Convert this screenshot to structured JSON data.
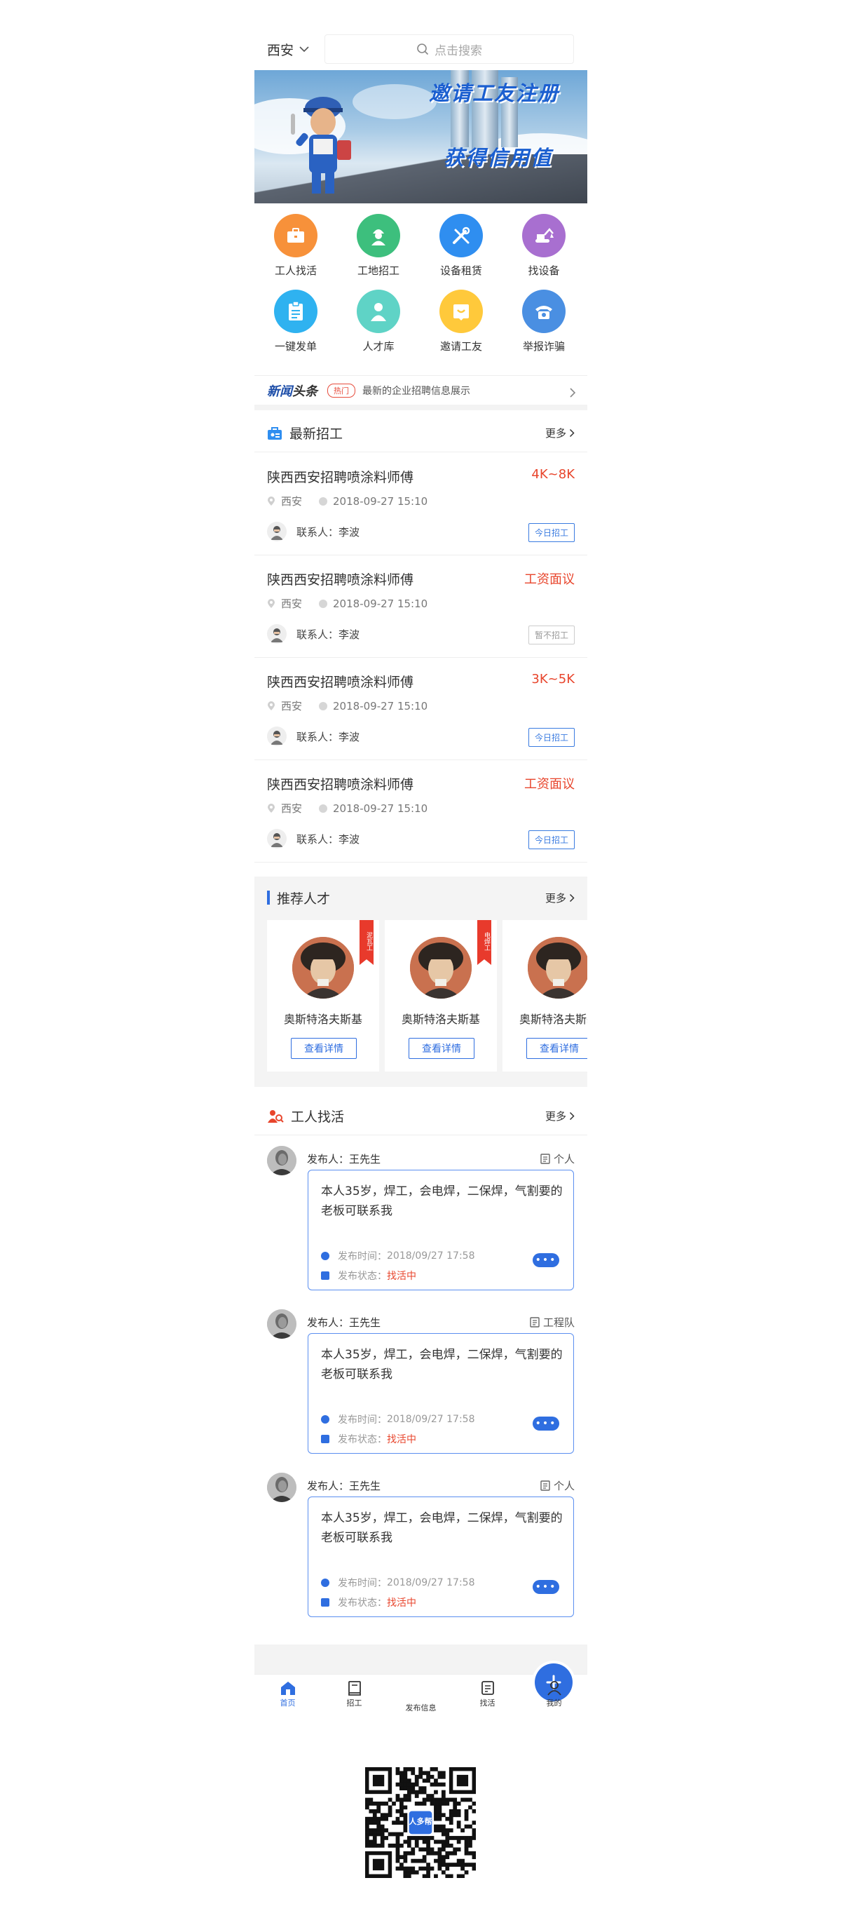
{
  "header": {
    "city": "西安",
    "search_placeholder": "点击搜索"
  },
  "banner": {
    "line1": "邀请工友注册",
    "line2": "获得信用值"
  },
  "grid": [
    {
      "label": "工人找活",
      "color": "#f7913a",
      "icon": "briefcase-icon"
    },
    {
      "label": "工地招工",
      "color": "#3dbf7d",
      "icon": "worker-icon"
    },
    {
      "label": "设备租赁",
      "color": "#2f8ef0",
      "icon": "tools-icon"
    },
    {
      "label": "找设备",
      "color": "#a86fd0",
      "icon": "excavator-icon"
    },
    {
      "label": "一键发单",
      "color": "#2fb2f0",
      "icon": "clipboard-icon"
    },
    {
      "label": "人才库",
      "color": "#5fd3c6",
      "icon": "person-icon"
    },
    {
      "label": "邀请工友",
      "color": "#ffc93b",
      "icon": "invite-icon"
    },
    {
      "label": "举报诈骗",
      "color": "#4a8fe2",
      "icon": "phone-icon"
    }
  ],
  "news": {
    "brand_a": "新闻",
    "brand_b": "头条",
    "badge": "热门",
    "text": "最新的企业招聘信息展示"
  },
  "jobs_section": {
    "title": "最新招工",
    "more": "更多"
  },
  "jobs": [
    {
      "title": "陕西西安招聘喷涂料师傅",
      "salary": "4K~8K",
      "city": "西安",
      "time": "2018-09-27 15:10",
      "contact": "联系人：李波",
      "tag": "今日招工"
    },
    {
      "title": "陕西西安招聘喷涂料师傅",
      "salary": "工资面议",
      "city": "西安",
      "time": "2018-09-27 15:10",
      "contact": "联系人：李波",
      "tag": "暂不招工"
    },
    {
      "title": "陕西西安招聘喷涂料师傅",
      "salary": "3K~5K",
      "city": "西安",
      "time": "2018-09-27 15:10",
      "contact": "联系人：李波",
      "tag": "今日招工"
    },
    {
      "title": "陕西西安招聘喷涂料师傅",
      "salary": "工资面议",
      "city": "西安",
      "time": "2018-09-27 15:10",
      "contact": "联系人：李波",
      "tag": "今日招工"
    }
  ],
  "talent_section": {
    "title": "推荐人才",
    "more": "更多"
  },
  "talents": [
    {
      "name": "奥斯特洛夫斯基",
      "ribbon": "泥瓦工",
      "button": "查看详情"
    },
    {
      "name": "奥斯特洛夫斯基",
      "ribbon": "电焊工",
      "button": "查看详情"
    },
    {
      "name": "奥斯特洛夫斯基",
      "ribbon": "",
      "button": "查看详情"
    }
  ],
  "workers_section": {
    "title": "工人找活",
    "more": "更多"
  },
  "posts": [
    {
      "publisher": "发布人：王先生",
      "kind": "个人",
      "desc": "本人35岁，焊工，会电焊，二保焊，气割要的老板可联系我",
      "time_label": "发布时间：",
      "time": "2018/09/27 17:58",
      "status_label": "发布状态：",
      "status": "找活中"
    },
    {
      "publisher": "发布人：王先生",
      "kind": "工程队",
      "desc": "本人35岁，焊工，会电焊，二保焊，气割要的老板可联系我",
      "time_label": "发布时间：",
      "time": "2018/09/27 17:58",
      "status_label": "发布状态：",
      "status": "找活中"
    },
    {
      "publisher": "发布人：王先生",
      "kind": "个人",
      "desc": "本人35岁，焊工，会电焊，二保焊，气割要的老板可联系我",
      "time_label": "发布时间：",
      "time": "2018/09/27 17:58",
      "status_label": "发布状态：",
      "status": "找活中"
    }
  ],
  "tabbar": [
    {
      "label": "首页",
      "icon": "home-icon",
      "active": true
    },
    {
      "label": "招工",
      "icon": "book-icon",
      "active": false
    },
    {
      "label": "发布信息",
      "icon": "plus-icon",
      "active": false
    },
    {
      "label": "找活",
      "icon": "list-icon",
      "active": false
    },
    {
      "label": "我的",
      "icon": "user-icon",
      "active": false
    }
  ],
  "qr": {
    "logo_text": "人多帮"
  },
  "colors": {
    "primary": "#2f6ee0",
    "accent_red": "#e8452c"
  }
}
